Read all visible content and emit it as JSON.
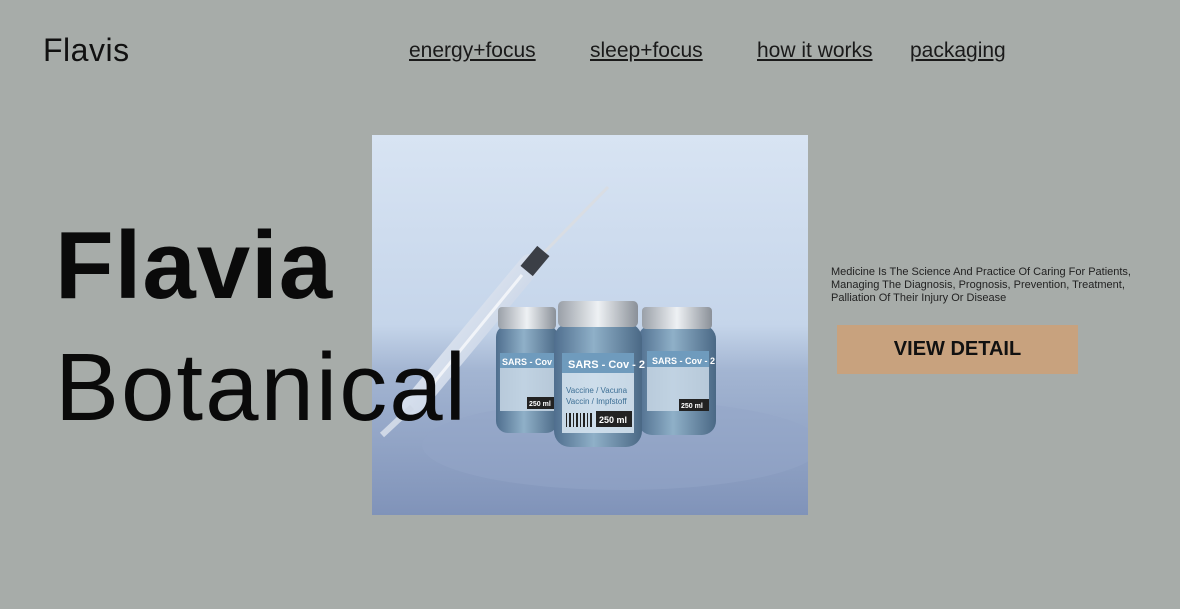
{
  "brand": {
    "name": "Flavis"
  },
  "nav": {
    "items": [
      {
        "label": "energy+focus"
      },
      {
        "label": "sleep+focus"
      },
      {
        "label": "how it works"
      },
      {
        "label": "packaging"
      }
    ]
  },
  "hero": {
    "title_line1": "Flavia",
    "title_line2": "Botanical",
    "image": {
      "vial_label": "SARS - Cov - 2",
      "vial_text_1": "Vaccine / Vacuna",
      "vial_text_2": "Vaccin / Impfstoff",
      "vial_volume": "250 ml"
    },
    "description": "Medicine Is The Science And Practice Of Caring For Patients, Managing The Diagnosis, Prognosis, Prevention, Treatment,  Palliation Of Their Injury Or Disease",
    "cta_label": "VIEW DETAIL"
  },
  "colors": {
    "background": "#a7aca9",
    "cta": "#c8a27e",
    "text": "#111111"
  }
}
